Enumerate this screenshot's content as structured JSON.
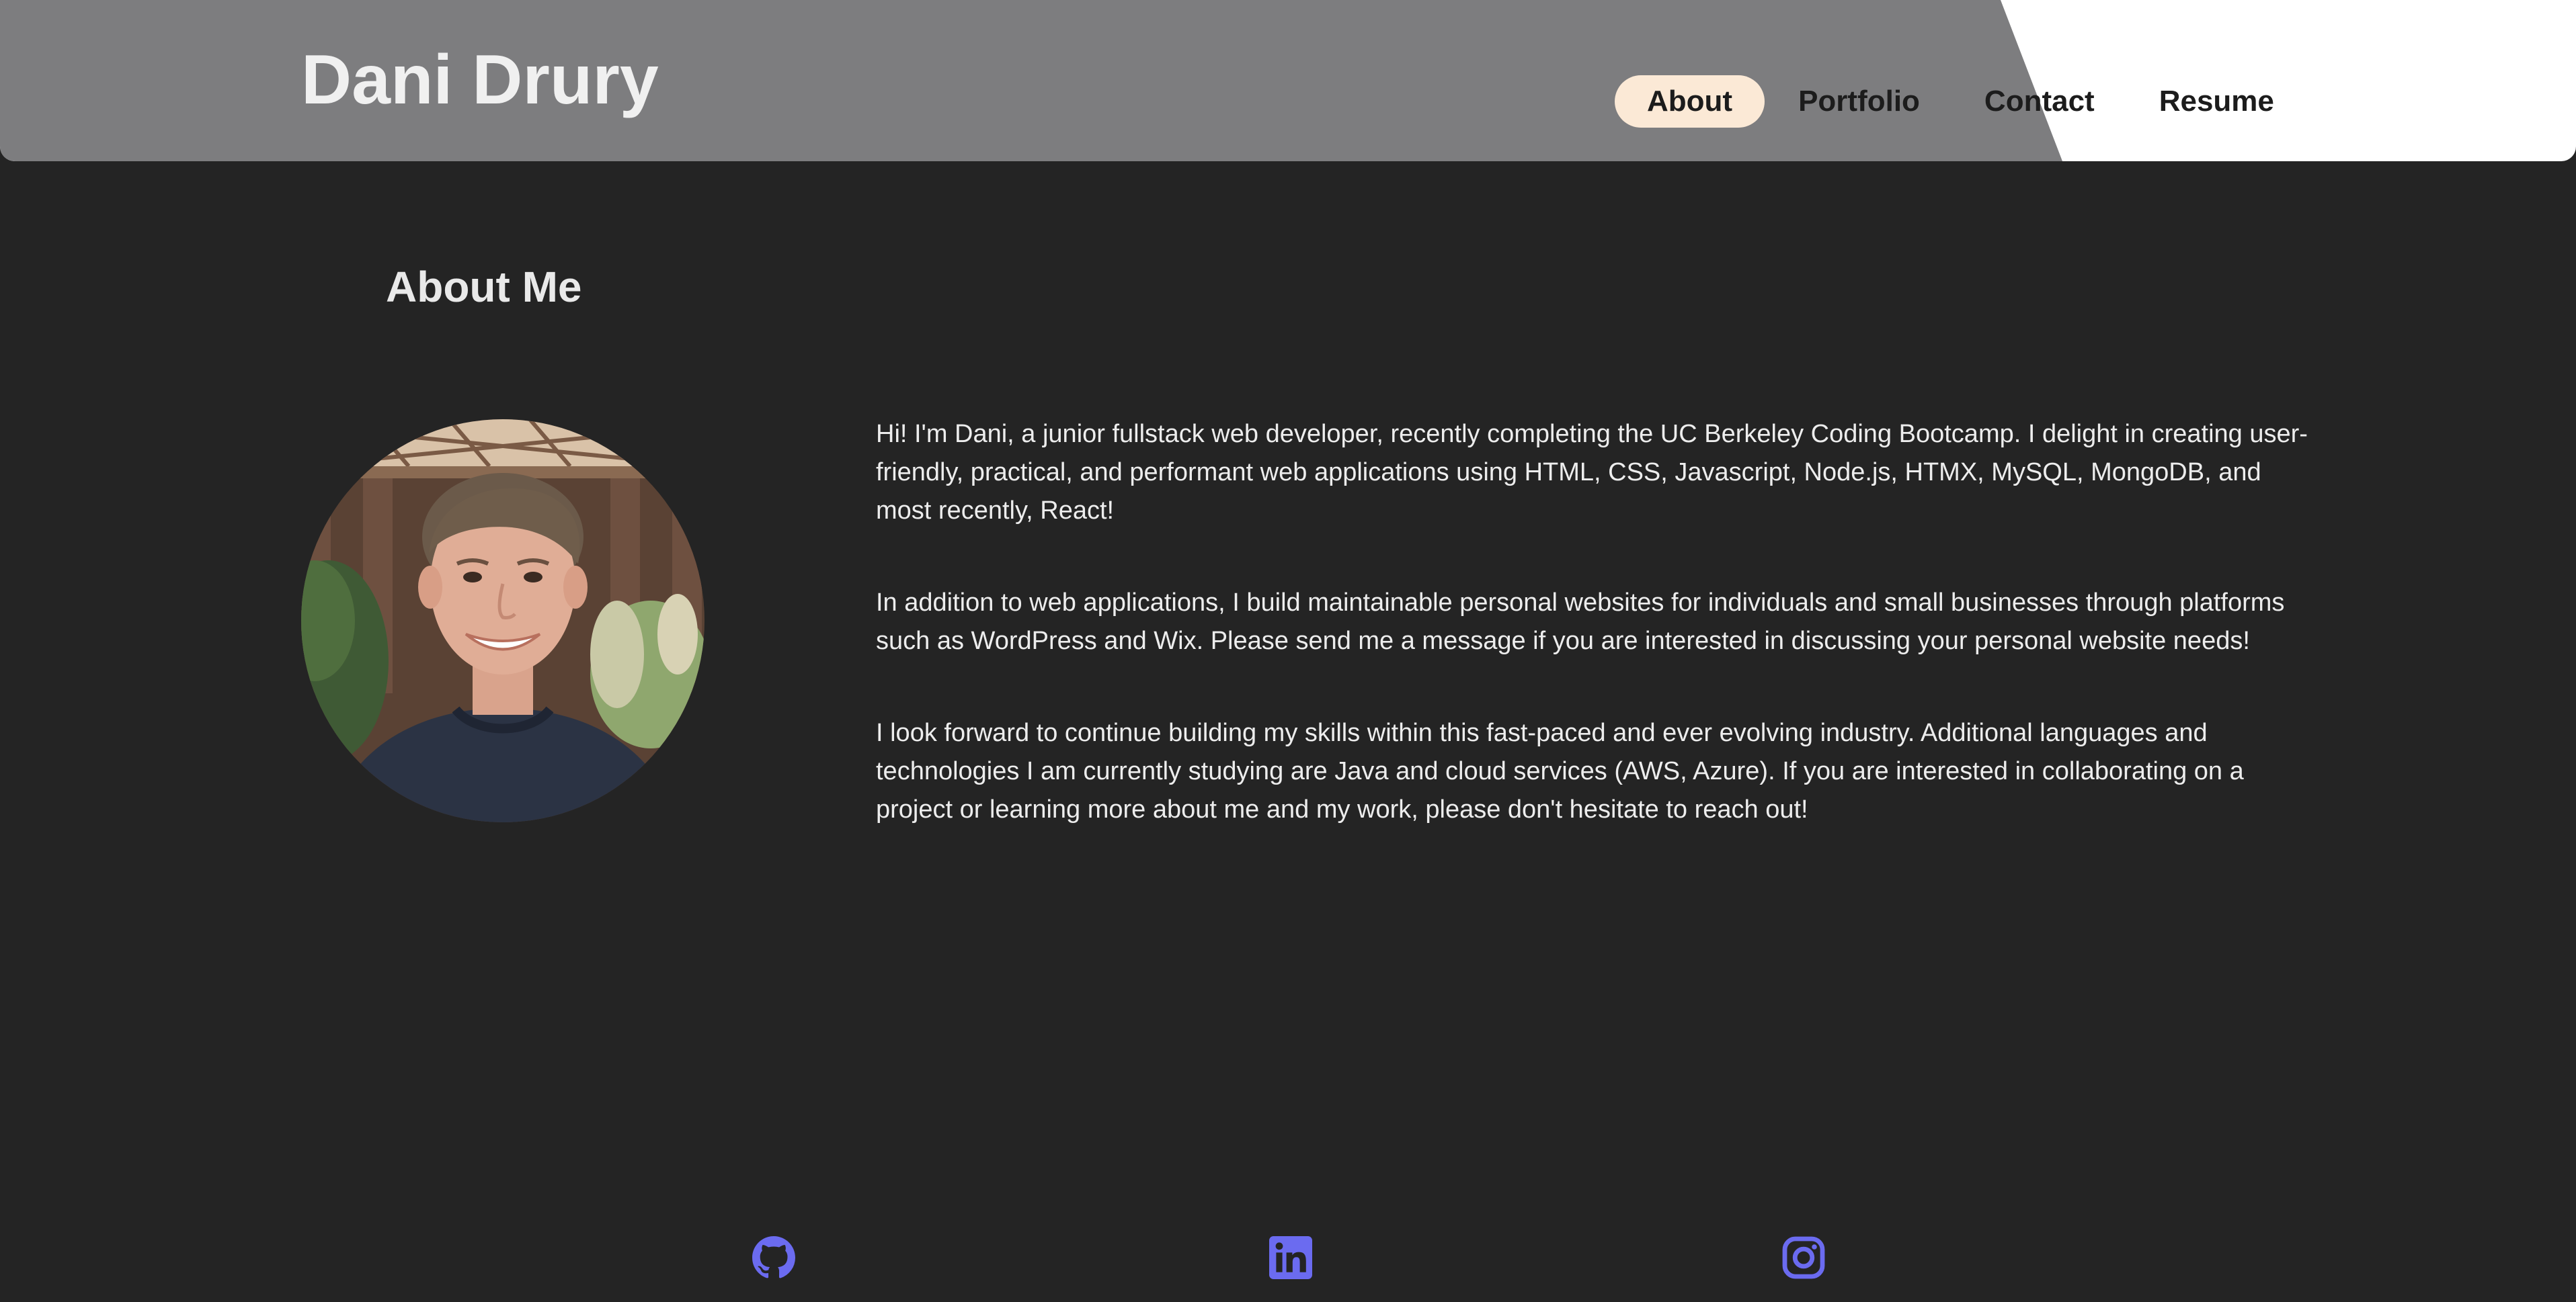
{
  "site": {
    "title": "Dani Drury"
  },
  "nav": {
    "items": [
      {
        "label": "About",
        "active": true
      },
      {
        "label": "Portfolio",
        "active": false
      },
      {
        "label": "Contact",
        "active": false
      },
      {
        "label": "Resume",
        "active": false
      }
    ]
  },
  "about": {
    "heading": "About Me",
    "paragraphs": [
      "Hi! I'm Dani, a junior fullstack web developer, recently completing the UC Berkeley Coding Bootcamp. I delight in creating user-friendly, practical, and performant web applications using HTML, CSS, Javascript, Node.js, HTMX, MySQL, MongoDB, and most recently, React!",
      "In addition to web applications, I build maintainable personal websites for individuals and small businesses through platforms such as WordPress and Wix. Please send me a message if you are interested in discussing your personal website needs!",
      "I look forward to continue building my skills within this fast-paced and ever evolving industry. Additional languages and technologies I am currently studying are Java and cloud services (AWS, Azure). If you are interested in collaborating on a project or learning more about me and my work, please don't hesitate to reach out!"
    ]
  },
  "social": {
    "icons": [
      "github-icon",
      "linkedin-icon",
      "instagram-icon"
    ]
  },
  "colors": {
    "background": "#242424",
    "header_gray": "#7d7d7f",
    "nav_active_bg": "#fbe9d6",
    "social_icon": "#6b6bf0"
  }
}
